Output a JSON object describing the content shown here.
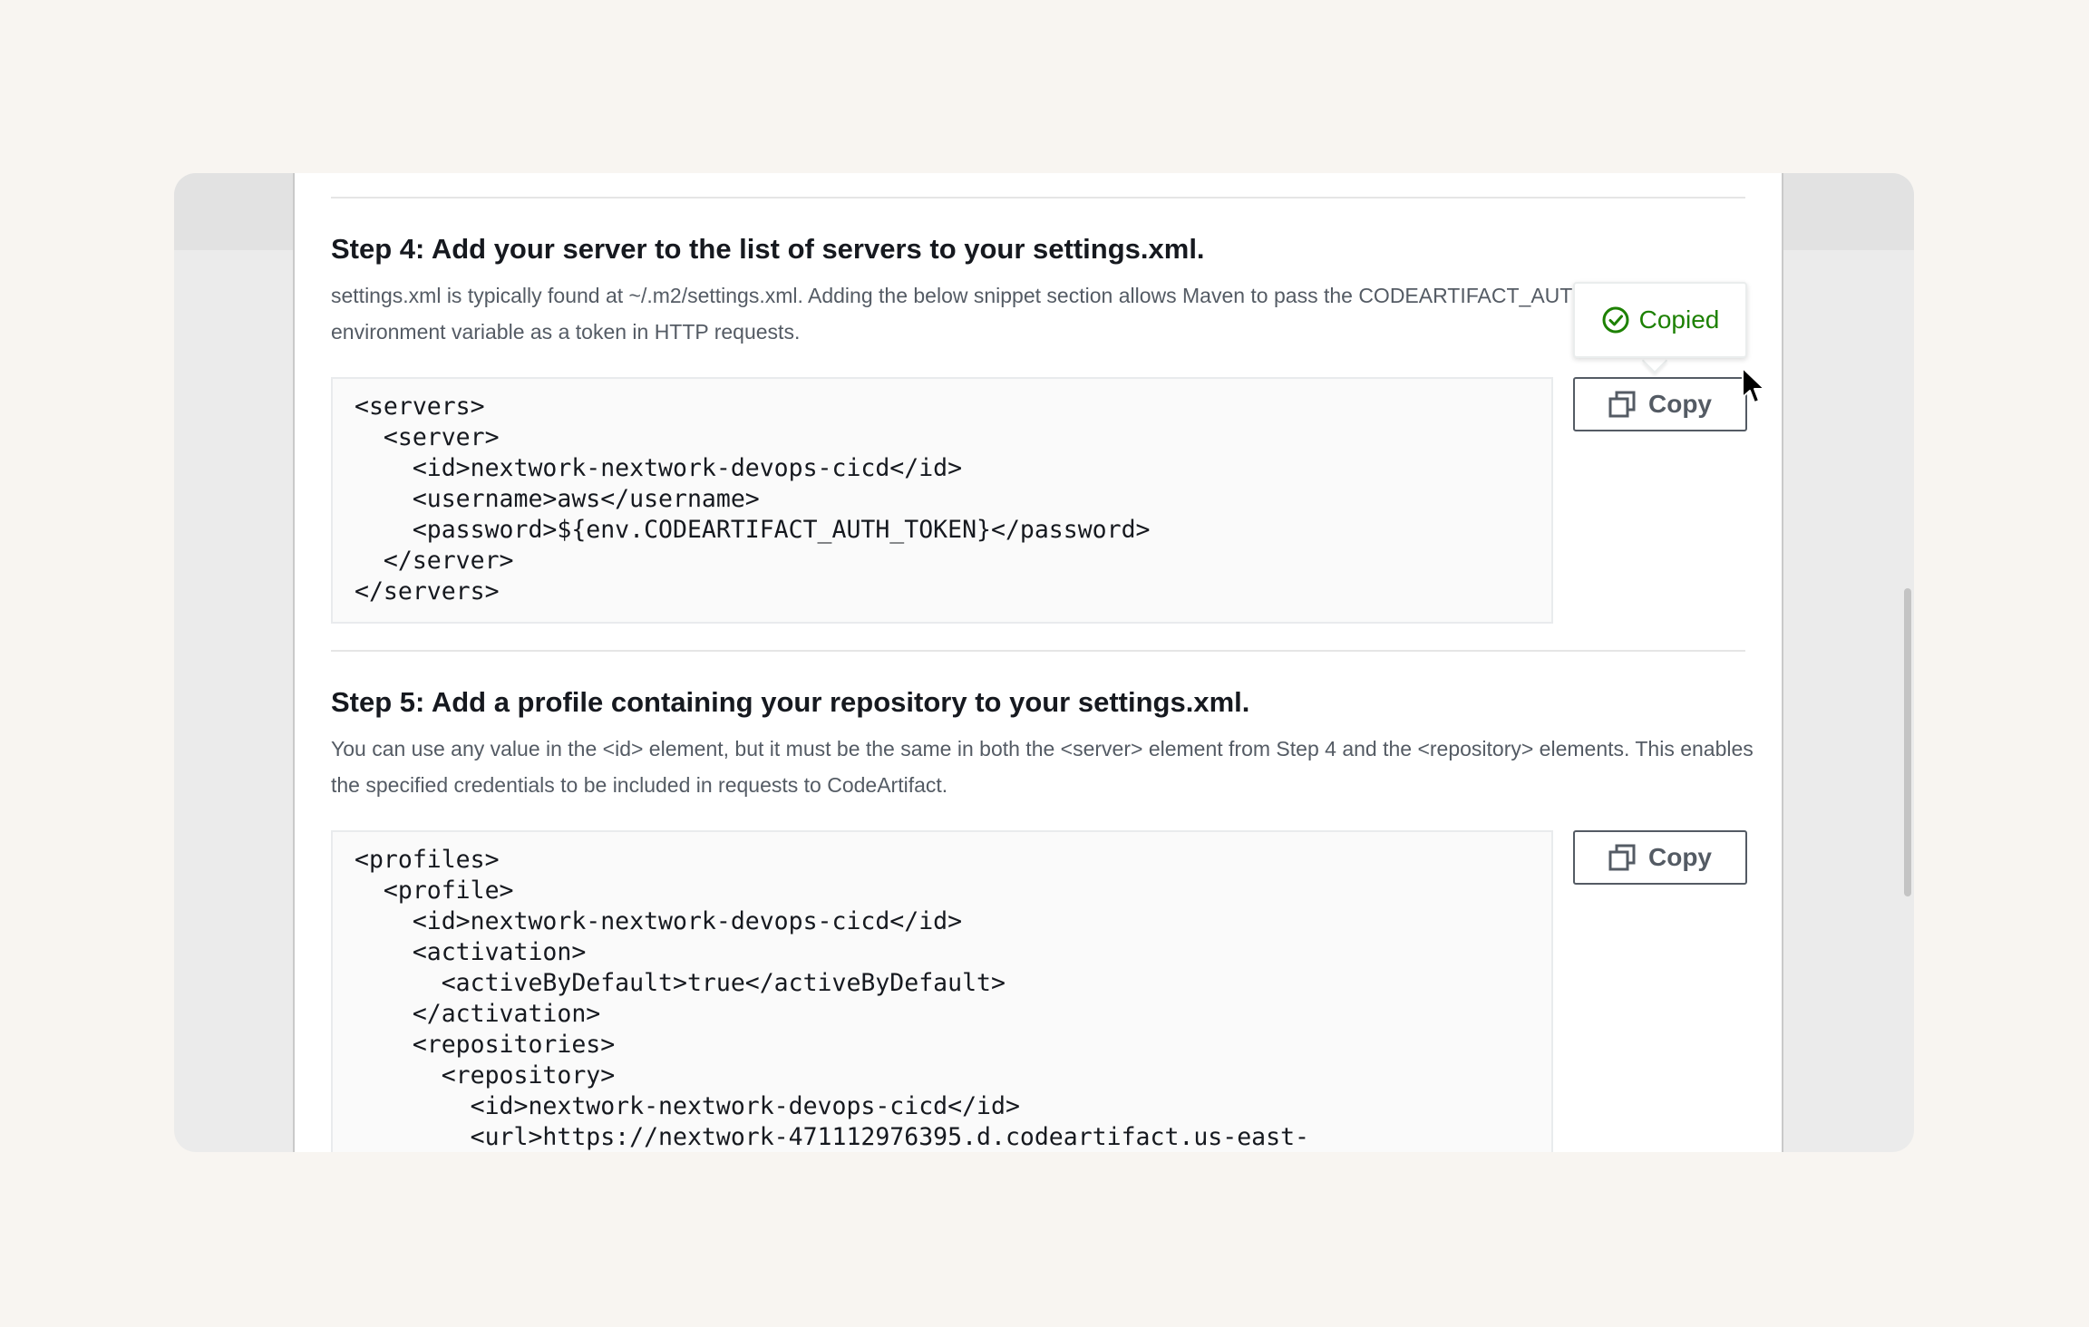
{
  "step4": {
    "title": "Step 4: Add your server to the list of servers to your settings.xml.",
    "description": "settings.xml is typically found at ~/.m2/settings.xml. Adding the below snippet section allows Maven to pass the CODEARTIFACT_AUTH_TOKEN environment variable as a token in HTTP requests.",
    "code_lines": [
      "<servers>",
      "  <server>",
      "    <id>nextwork-nextwork-devops-cicd</id>",
      "    <username>aws</username>",
      "    <password>${env.CODEARTIFACT_AUTH_TOKEN}</password>",
      "  </server>",
      "</servers>"
    ],
    "copy_label": "Copy",
    "copied_label": "Copied"
  },
  "step5": {
    "title": "Step 5: Add a profile containing your repository to your settings.xml.",
    "description": "You can use any value in the <id> element, but it must be the same in both the <server> element from Step 4 and the <repository> elements. This enables the specified credentials to be included in requests to CodeArtifact.",
    "code_lines": [
      "<profiles>",
      "  <profile>",
      "    <id>nextwork-nextwork-devops-cicd</id>",
      "    <activation>",
      "      <activeByDefault>true</activeByDefault>",
      "    </activation>",
      "    <repositories>",
      "      <repository>",
      "        <id>nextwork-nextwork-devops-cicd</id>",
      "        <url>https://nextwork-471112976395.d.codeartifact.us-east-"
    ],
    "copy_label": "Copy"
  },
  "colors": {
    "copied_green": "#1d8102",
    "button_border": "#545b64",
    "heading": "#16191f"
  },
  "icons": [
    "copy-icon",
    "check-circle-icon",
    "mouse-cursor-icon"
  ]
}
